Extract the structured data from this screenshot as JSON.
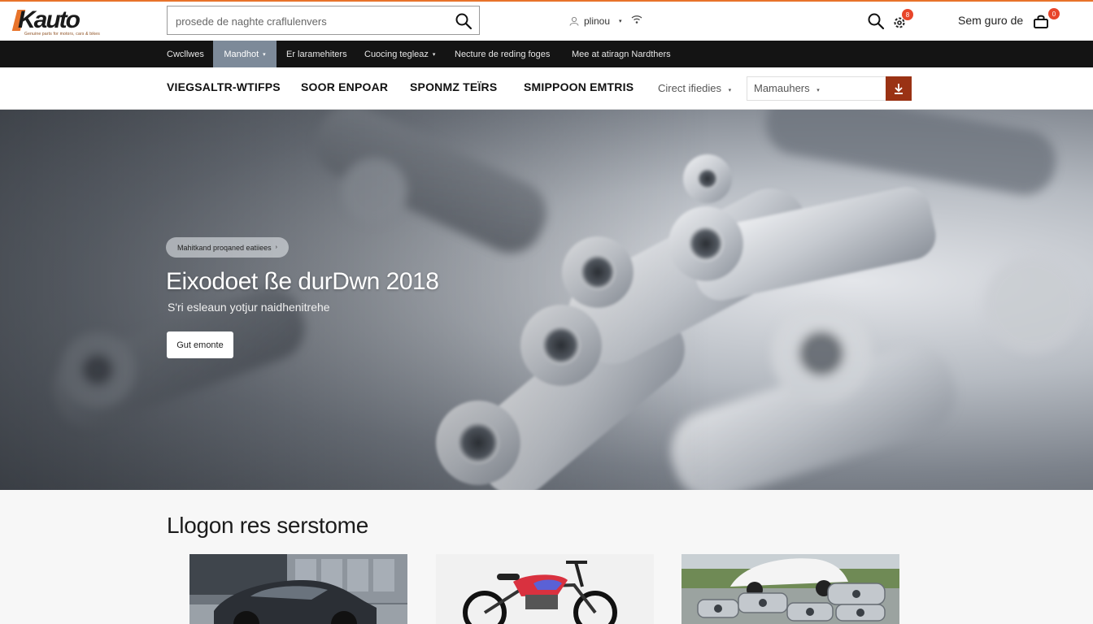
{
  "header": {
    "logo": "Kauto",
    "logo_tagline": "Genuine parts for motors, cars & bikes",
    "search_placeholder": "prosede de naghte craflulenvers",
    "phone": "plinou",
    "account_label": "Sem guro de",
    "notification_count": "8",
    "cart_count": "0"
  },
  "dark_nav": {
    "items": [
      {
        "label": "Cwcllwes",
        "has_caret": false
      },
      {
        "label": "Mandhot",
        "has_caret": true,
        "active": true
      },
      {
        "label": "Er laramehiters",
        "has_caret": false
      },
      {
        "label": "Cuocing tegleaz",
        "has_caret": true
      },
      {
        "label": "Necture de reding foges",
        "has_caret": false
      },
      {
        "label": "Mee at atiragn Nardthers",
        "has_caret": false
      }
    ]
  },
  "category_nav": {
    "items": [
      "VIEGSALTR-WTIFPS",
      "SOOR ENPOAR",
      "SPONMZ TEÏRS",
      "SMIPPOON EMTRIS"
    ],
    "secondary": "Cirect ifiedies",
    "filter_value": "Mamauhers",
    "accent_color": "#9a3214"
  },
  "hero": {
    "pill": "Mahitkand proqaned eatiiees",
    "title": "Eixodoet ße durDwn 2018",
    "subtitle": "S'ri esleaun yotjur naidhenitrehe",
    "cta": "Gut emonte"
  },
  "featured": {
    "title": "Llogon res serstome"
  },
  "colors": {
    "accent": "#e8732a",
    "dark_nav": "#141414",
    "active_nav": "#7d8a99"
  }
}
